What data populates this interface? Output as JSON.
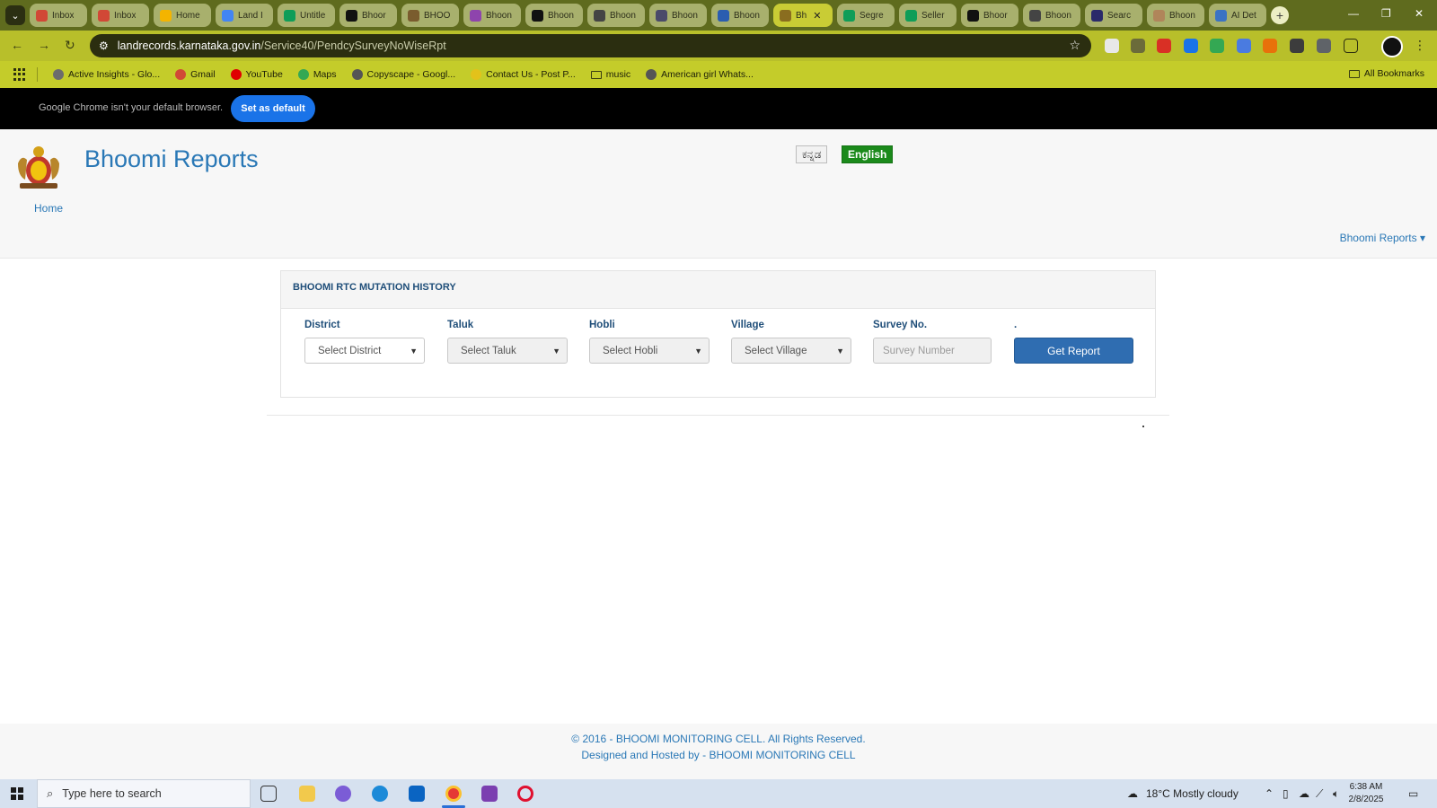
{
  "browser": {
    "tabs": [
      {
        "title": "Inbox",
        "color": "#d14836"
      },
      {
        "title": "Inbox",
        "color": "#d14836"
      },
      {
        "title": "Home",
        "color": "#f4b400"
      },
      {
        "title": "Land I",
        "color": "#4285f4"
      },
      {
        "title": "Untitle",
        "color": "#0f9d58"
      },
      {
        "title": "Bhoor",
        "color": "#111111"
      },
      {
        "title": "BHOO",
        "color": "#7a5c2e"
      },
      {
        "title": "Bhoon",
        "color": "#8e44ad"
      },
      {
        "title": "Bhoon",
        "color": "#111111"
      },
      {
        "title": "Bhoon",
        "color": "#444444"
      },
      {
        "title": "Bhoon",
        "color": "#4a4a6a"
      },
      {
        "title": "Bhoon",
        "color": "#2a5db0"
      },
      {
        "title": "Bh",
        "color": "#8a6d1f",
        "active": true
      },
      {
        "title": "Segre",
        "color": "#0f9d58"
      },
      {
        "title": "Seller",
        "color": "#0f9d58"
      },
      {
        "title": "Bhoor",
        "color": "#111111"
      },
      {
        "title": "Bhoon",
        "color": "#444444"
      },
      {
        "title": "Searc",
        "color": "#2a2a6a"
      },
      {
        "title": "Bhoon",
        "color": "#b0855a"
      },
      {
        "title": "AI Det",
        "color": "#3b73c4"
      }
    ],
    "url_host": "landrecords.karnataka.gov.in",
    "url_path": "/Service40/PendcySurveyNoWiseRpt",
    "bookmarks": [
      {
        "label": "Active Insights - Glo...",
        "color": "#6c6c6c"
      },
      {
        "label": "Gmail",
        "color": "#d14836"
      },
      {
        "label": "YouTube",
        "color": "#e00000"
      },
      {
        "label": "Maps",
        "color": "#34a853"
      },
      {
        "label": "Copyscape - Googl...",
        "color": "#555555"
      },
      {
        "label": "Contact Us - Post P...",
        "color": "#e3c21a"
      },
      {
        "label": "music",
        "color": "folder"
      },
      {
        "label": "American girl Whats...",
        "color": "#555555"
      }
    ],
    "all_bookmarks": "All Bookmarks",
    "banner_message": "Google Chrome isn't your default browser.",
    "set_default": "Set as default"
  },
  "page": {
    "title": "Bhoomi Reports",
    "home": "Home",
    "lang_kannada": "ಕನ್ನಡ",
    "lang_english": "English",
    "reports_menu": "Bhoomi Reports ▾",
    "panel_title": "BHOOMI RTC MUTATION HISTORY",
    "fields": {
      "district_label": "District",
      "district_value": "Select District",
      "taluk_label": "Taluk",
      "taluk_value": "Select Taluk",
      "hobli_label": "Hobli",
      "hobli_value": "Select Hobli",
      "village_label": "Village",
      "village_value": "Select Village",
      "survey_label": "Survey No.",
      "survey_placeholder": "Survey Number",
      "button_label_dot": "."
    },
    "get_report": "Get Report",
    "footer_line1": "© 2016 - BHOOMI MONITORING CELL. All Rights Reserved.",
    "footer_line2": "Designed and Hosted by - BHOOMI MONITORING CELL"
  },
  "taskbar": {
    "search_placeholder": "Type here to search",
    "weather": "18°C  Mostly cloudy",
    "time": "6:38 AM",
    "date": "2/8/2025"
  }
}
